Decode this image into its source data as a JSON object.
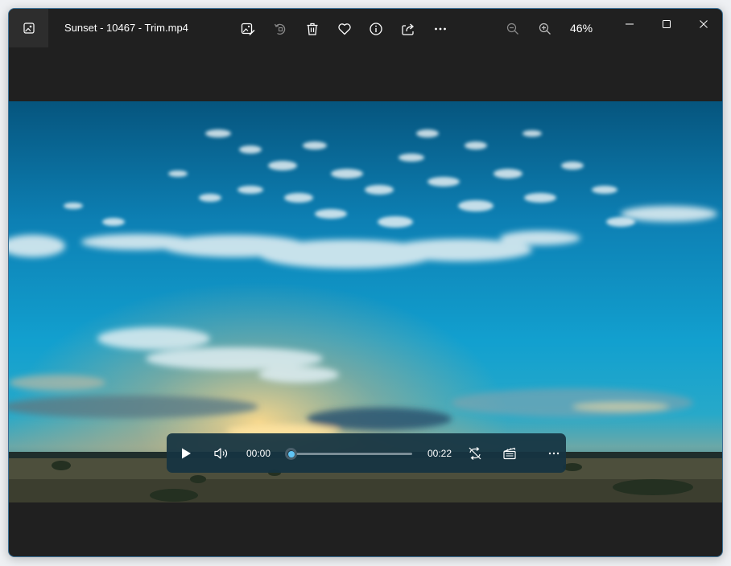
{
  "app": {
    "title": "Sunset - 10467 - Trim.mp4",
    "zoom": "46%"
  },
  "toolbar": {
    "icons": [
      "edit-image-icon",
      "rotate-icon",
      "delete-icon",
      "favorite-icon",
      "info-icon",
      "share-icon",
      "more-icon",
      "zoom-out-icon",
      "zoom-in-icon"
    ]
  },
  "window_controls": [
    "minimize-icon",
    "maximize-icon",
    "close-icon"
  ],
  "player": {
    "current_time": "00:00",
    "duration": "00:22",
    "progress": 0.0
  },
  "colors": {
    "window_bg": "#202020",
    "accent": "#60c4f4",
    "controls_bg": "#163442"
  }
}
